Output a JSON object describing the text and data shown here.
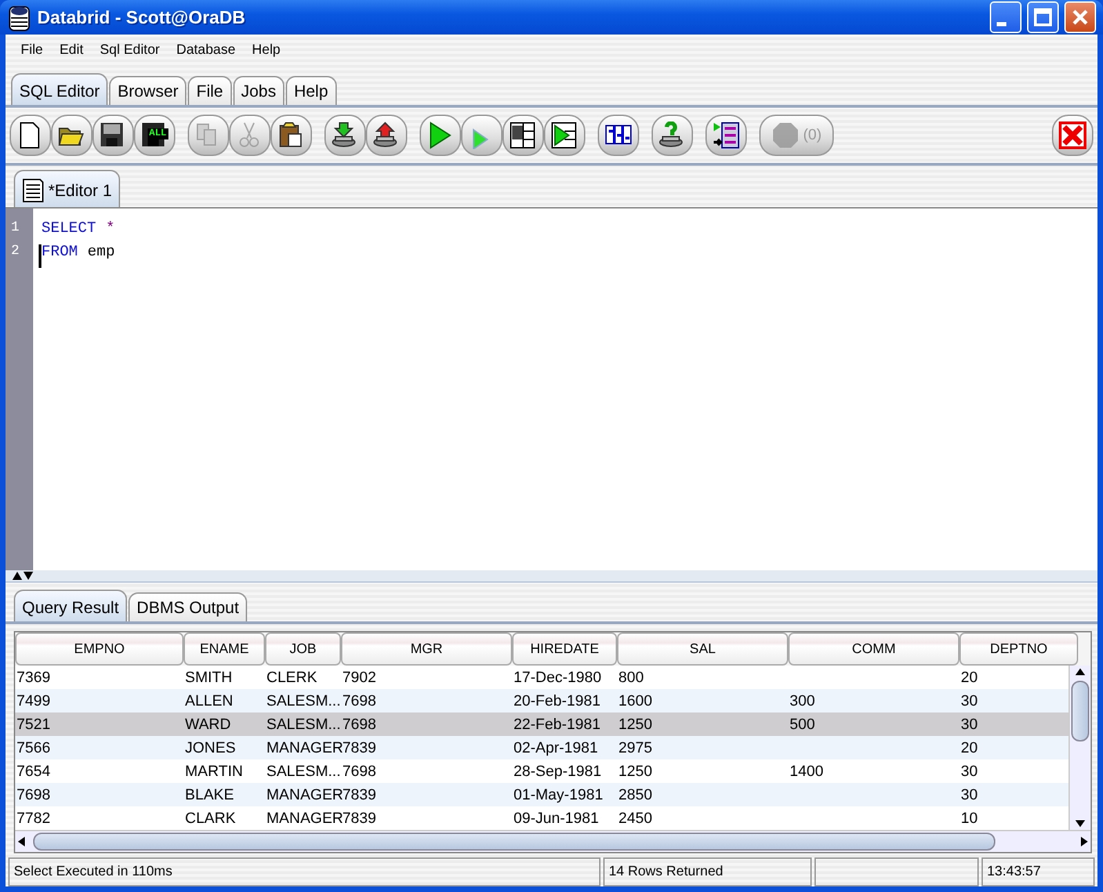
{
  "window": {
    "title": "Databrid - Scott@OraDB"
  },
  "menu": [
    "File",
    "Edit",
    "Sql Editor",
    "Database",
    "Help"
  ],
  "tabs": [
    {
      "label": "SQL Editor",
      "selected": true
    },
    {
      "label": "Browser",
      "selected": false
    },
    {
      "label": "File",
      "selected": false
    },
    {
      "label": "Jobs",
      "selected": false
    },
    {
      "label": "Help",
      "selected": false
    }
  ],
  "toolbar": {
    "groups": [
      [
        {
          "kind": "new",
          "disabled": false
        },
        {
          "kind": "open",
          "disabled": false
        },
        {
          "kind": "save",
          "disabled": false
        },
        {
          "kind": "save-all",
          "label": "ALL",
          "disabled": false
        }
      ],
      [
        {
          "kind": "copy",
          "disabled": true
        },
        {
          "kind": "cut",
          "disabled": true
        },
        {
          "kind": "paste",
          "disabled": false
        }
      ],
      [
        {
          "kind": "import",
          "disabled": false
        },
        {
          "kind": "export",
          "disabled": false
        }
      ],
      [
        {
          "kind": "run",
          "disabled": false
        },
        {
          "kind": "run-step",
          "disabled": false
        },
        {
          "kind": "run-grid",
          "disabled": false
        },
        {
          "kind": "run-all",
          "disabled": false
        }
      ],
      [
        {
          "kind": "format",
          "disabled": false
        }
      ],
      [
        {
          "kind": "query-help",
          "disabled": false
        }
      ],
      [
        {
          "kind": "batch",
          "disabled": false
        }
      ],
      [
        {
          "kind": "stop",
          "label": "(0)",
          "disabled": true
        }
      ]
    ],
    "close": {
      "kind": "close",
      "disabled": false
    }
  },
  "editor_tabs": [
    {
      "label": "*Editor 1",
      "selected": true
    }
  ],
  "editor": {
    "lines": [
      {
        "number": "1",
        "caret": false,
        "tokens": [
          {
            "text": "SELECT",
            "kind": "keyword"
          },
          {
            "text": "*",
            "kind": "operator"
          }
        ]
      },
      {
        "number": "2",
        "caret": true,
        "tokens": [
          {
            "text": "FROM",
            "kind": "keyword"
          },
          {
            "text": "emp",
            "kind": "plain"
          }
        ]
      }
    ]
  },
  "result_tabs": [
    {
      "label": "Query Result",
      "selected": true
    },
    {
      "label": "DBMS Output",
      "selected": false
    }
  ],
  "table": {
    "columns": [
      "EMPNO",
      "ENAME",
      "JOB",
      "MGR",
      "HIREDATE",
      "SAL",
      "COMM",
      "DEPTNO"
    ],
    "rows": [
      {
        "cells": [
          "7369",
          "SMITH",
          "CLERK",
          "7902",
          "17-Dec-1980",
          "800",
          "",
          "20"
        ],
        "selected": false
      },
      {
        "cells": [
          "7499",
          "ALLEN",
          "SALESM...",
          "7698",
          "20-Feb-1981",
          "1600",
          "300",
          "30"
        ],
        "selected": false
      },
      {
        "cells": [
          "7521",
          "WARD",
          "SALESM...",
          "7698",
          "22-Feb-1981",
          "1250",
          "500",
          "30"
        ],
        "selected": true
      },
      {
        "cells": [
          "7566",
          "JONES",
          "MANAGER",
          "7839",
          "02-Apr-1981",
          "2975",
          "",
          "20"
        ],
        "selected": false
      },
      {
        "cells": [
          "7654",
          "MARTIN",
          "SALESM...",
          "7698",
          "28-Sep-1981",
          "1250",
          "1400",
          "30"
        ],
        "selected": false
      },
      {
        "cells": [
          "7698",
          "BLAKE",
          "MANAGER",
          "7839",
          "01-May-1981",
          "2850",
          "",
          "30"
        ],
        "selected": false
      },
      {
        "cells": [
          "7782",
          "CLARK",
          "MANAGER",
          "7839",
          "09-Jun-1981",
          "2450",
          "",
          "10"
        ],
        "selected": false
      }
    ]
  },
  "status_bar": {
    "message": "Select Executed in 110ms",
    "rows": "14 Rows Returned",
    "time": "13:43:57"
  }
}
